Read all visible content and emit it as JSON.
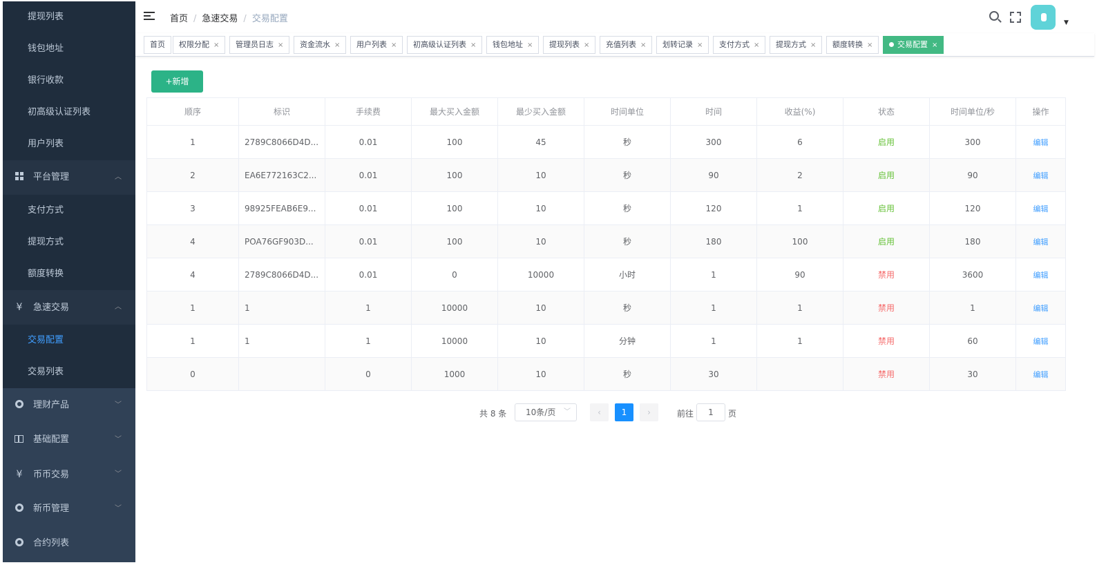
{
  "sidebar": {
    "top_items": [
      "提现列表",
      "钱包地址",
      "银行收款",
      "初高级认证列表",
      "用户列表"
    ],
    "platform_group": {
      "label": "平台管理",
      "items": [
        "支付方式",
        "提现方式",
        "额度转换"
      ]
    },
    "fast_trade_group": {
      "icon": "¥",
      "label": "急速交易",
      "items": [
        "交易配置",
        "交易列表"
      ]
    },
    "collapsed_groups": [
      {
        "icon": "ring-icon",
        "label": "理财产品"
      },
      {
        "icon": "book-icon",
        "label": "基础配置"
      },
      {
        "icon": "¥",
        "label": "币币交易"
      },
      {
        "icon": "ring-icon",
        "label": "新币管理"
      },
      {
        "icon": "ring-icon",
        "label": "合约列表"
      }
    ]
  },
  "breadcrumb": {
    "home": "首页",
    "parent": "急速交易",
    "current": "交易配置"
  },
  "tags": [
    "首页",
    "权限分配",
    "管理员日志",
    "资金流水",
    "用户列表",
    "初高级认证列表",
    "钱包地址",
    "提现列表",
    "充值列表",
    "划转记录",
    "支付方式",
    "提现方式",
    "额度转换",
    "交易配置"
  ],
  "add_button": "+新增",
  "table": {
    "headers": [
      "顺序",
      "标识",
      "手续费",
      "最大买入金额",
      "最少买入金额",
      "时间单位",
      "时间",
      "收益(%)",
      "状态",
      "时间单位/秒",
      "操作"
    ],
    "rows": [
      [
        "1",
        "2789C8066D4D...",
        "0.01",
        "100",
        "45",
        "秒",
        "300",
        "6",
        "启用",
        "300",
        "编辑"
      ],
      [
        "2",
        "EA6E772163C2...",
        "0.01",
        "100",
        "10",
        "秒",
        "90",
        "2",
        "启用",
        "90",
        "编辑"
      ],
      [
        "3",
        "98925FEAB6E9...",
        "0.01",
        "100",
        "10",
        "秒",
        "120",
        "1",
        "启用",
        "120",
        "编辑"
      ],
      [
        "4",
        "POA76GF903D...",
        "0.01",
        "100",
        "10",
        "秒",
        "180",
        "100",
        "启用",
        "180",
        "编辑"
      ],
      [
        "4",
        "2789C8066D4D...",
        "0.01",
        "0",
        "10000",
        "小时",
        "1",
        "90",
        "禁用",
        "3600",
        "编辑"
      ],
      [
        "1",
        "1",
        "1",
        "10000",
        "10",
        "秒",
        "1",
        "1",
        "禁用",
        "1",
        "编辑"
      ],
      [
        "1",
        "1",
        "1",
        "10000",
        "10",
        "分钟",
        "1",
        "1",
        "禁用",
        "60",
        "编辑"
      ],
      [
        "0",
        "",
        "0",
        "1000",
        "10",
        "秒",
        "30",
        "",
        "禁用",
        "30",
        "编辑"
      ]
    ]
  },
  "pagination": {
    "total": "共 8 条",
    "page_size": "10条/页",
    "prev": "‹",
    "current": "1",
    "next": "›",
    "goto_prefix": "前往",
    "goto_value": "1",
    "goto_suffix": "页"
  },
  "colors": {
    "sidebar_bg": "#304156",
    "submenu_bg": "#1f2d3d",
    "active_tag": "#42b983",
    "add_button": "#2cb387",
    "enabled": "#67c23a",
    "disabled": "#f56c6c",
    "primary": "#1890ff"
  }
}
